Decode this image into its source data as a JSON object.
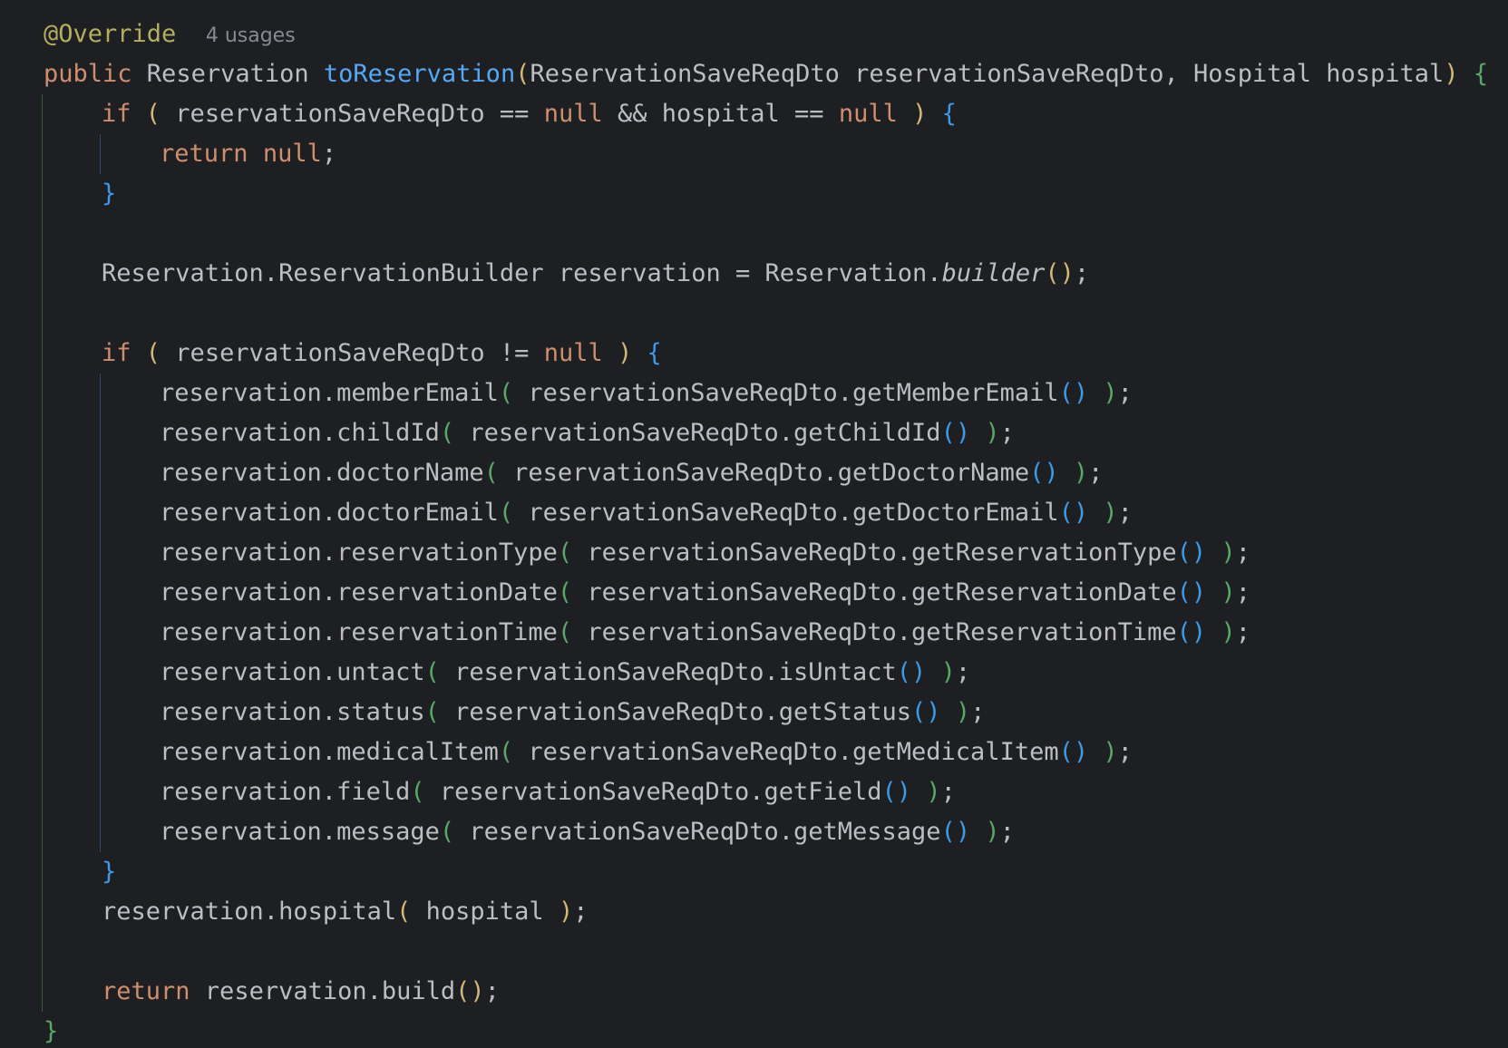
{
  "editor": {
    "colors": {
      "background": "#1e1f22",
      "default": "#bcbec4",
      "keyword": "#cf8e6d",
      "annotation": "#b3ae60",
      "method_decl": "#56a8f5",
      "inlay_hint": "#868a91",
      "brace_level1": "#59a869",
      "brace_level2": "#d5b778",
      "brace_level3": "#3d9ae8"
    },
    "lines": [
      {
        "indent": 0,
        "tokens": [
          {
            "t": "@Override",
            "c": "annotation"
          },
          {
            "t": "  ",
            "c": "default"
          },
          {
            "t": "4 usages",
            "c": "hint"
          }
        ]
      },
      {
        "indent": 0,
        "tokens": [
          {
            "t": "public",
            "c": "keyword"
          },
          {
            "t": " Reservation ",
            "c": "default"
          },
          {
            "t": "toReservation",
            "c": "method_decl"
          },
          {
            "t": "(",
            "c": "brace_level2"
          },
          {
            "t": "ReservationSaveReqDto reservationSaveReqDto, Hospital hospital",
            "c": "default"
          },
          {
            "t": ")",
            "c": "brace_level2"
          },
          {
            "t": " ",
            "c": "default"
          },
          {
            "t": "{",
            "c": "brace_level1"
          }
        ]
      },
      {
        "indent": 1,
        "tokens": [
          {
            "t": "if",
            "c": "keyword"
          },
          {
            "t": " ",
            "c": "default"
          },
          {
            "t": "(",
            "c": "brace_level2"
          },
          {
            "t": " reservationSaveReqDto == ",
            "c": "default"
          },
          {
            "t": "null",
            "c": "keyword"
          },
          {
            "t": " && hospital == ",
            "c": "default"
          },
          {
            "t": "null",
            "c": "keyword"
          },
          {
            "t": " ",
            "c": "default"
          },
          {
            "t": ")",
            "c": "brace_level2"
          },
          {
            "t": " ",
            "c": "default"
          },
          {
            "t": "{",
            "c": "brace_level3"
          }
        ]
      },
      {
        "indent": 2,
        "tokens": [
          {
            "t": "return",
            "c": "keyword"
          },
          {
            "t": " ",
            "c": "default"
          },
          {
            "t": "null",
            "c": "keyword"
          },
          {
            "t": ";",
            "c": "default"
          }
        ]
      },
      {
        "indent": 1,
        "tokens": [
          {
            "t": "}",
            "c": "brace_level3"
          }
        ]
      },
      {
        "indent": 0,
        "tokens": []
      },
      {
        "indent": 1,
        "tokens": [
          {
            "t": "Reservation.ReservationBuilder reservation = Reservation.",
            "c": "default"
          },
          {
            "t": "builder",
            "c": "italic"
          },
          {
            "t": "()",
            "c": "brace_level2"
          },
          {
            "t": ";",
            "c": "default"
          }
        ]
      },
      {
        "indent": 0,
        "tokens": []
      },
      {
        "indent": 1,
        "tokens": [
          {
            "t": "if",
            "c": "keyword"
          },
          {
            "t": " ",
            "c": "default"
          },
          {
            "t": "(",
            "c": "brace_level2"
          },
          {
            "t": " reservationSaveReqDto != ",
            "c": "default"
          },
          {
            "t": "null",
            "c": "keyword"
          },
          {
            "t": " ",
            "c": "default"
          },
          {
            "t": ")",
            "c": "brace_level2"
          },
          {
            "t": " ",
            "c": "default"
          },
          {
            "t": "{",
            "c": "brace_level3"
          }
        ]
      },
      {
        "indent": 2,
        "tokens": [
          {
            "t": "reservation.memberEmail",
            "c": "default"
          },
          {
            "t": "(",
            "c": "brace_level1"
          },
          {
            "t": " reservationSaveReqDto.getMemberEmail",
            "c": "default"
          },
          {
            "t": "()",
            "c": "brace_level3"
          },
          {
            "t": " ",
            "c": "default"
          },
          {
            "t": ")",
            "c": "brace_level1"
          },
          {
            "t": ";",
            "c": "default"
          }
        ]
      },
      {
        "indent": 2,
        "tokens": [
          {
            "t": "reservation.childId",
            "c": "default"
          },
          {
            "t": "(",
            "c": "brace_level1"
          },
          {
            "t": " reservationSaveReqDto.getChildId",
            "c": "default"
          },
          {
            "t": "()",
            "c": "brace_level3"
          },
          {
            "t": " ",
            "c": "default"
          },
          {
            "t": ")",
            "c": "brace_level1"
          },
          {
            "t": ";",
            "c": "default"
          }
        ]
      },
      {
        "indent": 2,
        "tokens": [
          {
            "t": "reservation.doctorName",
            "c": "default"
          },
          {
            "t": "(",
            "c": "brace_level1"
          },
          {
            "t": " reservationSaveReqDto.getDoctorName",
            "c": "default"
          },
          {
            "t": "()",
            "c": "brace_level3"
          },
          {
            "t": " ",
            "c": "default"
          },
          {
            "t": ")",
            "c": "brace_level1"
          },
          {
            "t": ";",
            "c": "default"
          }
        ]
      },
      {
        "indent": 2,
        "tokens": [
          {
            "t": "reservation.doctorEmail",
            "c": "default"
          },
          {
            "t": "(",
            "c": "brace_level1"
          },
          {
            "t": " reservationSaveReqDto.getDoctorEmail",
            "c": "default"
          },
          {
            "t": "()",
            "c": "brace_level3"
          },
          {
            "t": " ",
            "c": "default"
          },
          {
            "t": ")",
            "c": "brace_level1"
          },
          {
            "t": ";",
            "c": "default"
          }
        ]
      },
      {
        "indent": 2,
        "tokens": [
          {
            "t": "reservation.reservationType",
            "c": "default"
          },
          {
            "t": "(",
            "c": "brace_level1"
          },
          {
            "t": " reservationSaveReqDto.getReservationType",
            "c": "default"
          },
          {
            "t": "()",
            "c": "brace_level3"
          },
          {
            "t": " ",
            "c": "default"
          },
          {
            "t": ")",
            "c": "brace_level1"
          },
          {
            "t": ";",
            "c": "default"
          }
        ]
      },
      {
        "indent": 2,
        "tokens": [
          {
            "t": "reservation.reservationDate",
            "c": "default"
          },
          {
            "t": "(",
            "c": "brace_level1"
          },
          {
            "t": " reservationSaveReqDto.getReservationDate",
            "c": "default"
          },
          {
            "t": "()",
            "c": "brace_level3"
          },
          {
            "t": " ",
            "c": "default"
          },
          {
            "t": ")",
            "c": "brace_level1"
          },
          {
            "t": ";",
            "c": "default"
          }
        ]
      },
      {
        "indent": 2,
        "tokens": [
          {
            "t": "reservation.reservationTime",
            "c": "default"
          },
          {
            "t": "(",
            "c": "brace_level1"
          },
          {
            "t": " reservationSaveReqDto.getReservationTime",
            "c": "default"
          },
          {
            "t": "()",
            "c": "brace_level3"
          },
          {
            "t": " ",
            "c": "default"
          },
          {
            "t": ")",
            "c": "brace_level1"
          },
          {
            "t": ";",
            "c": "default"
          }
        ]
      },
      {
        "indent": 2,
        "tokens": [
          {
            "t": "reservation.untact",
            "c": "default"
          },
          {
            "t": "(",
            "c": "brace_level1"
          },
          {
            "t": " reservationSaveReqDto.isUntact",
            "c": "default"
          },
          {
            "t": "()",
            "c": "brace_level3"
          },
          {
            "t": " ",
            "c": "default"
          },
          {
            "t": ")",
            "c": "brace_level1"
          },
          {
            "t": ";",
            "c": "default"
          }
        ]
      },
      {
        "indent": 2,
        "tokens": [
          {
            "t": "reservation.status",
            "c": "default"
          },
          {
            "t": "(",
            "c": "brace_level1"
          },
          {
            "t": " reservationSaveReqDto.getStatus",
            "c": "default"
          },
          {
            "t": "()",
            "c": "brace_level3"
          },
          {
            "t": " ",
            "c": "default"
          },
          {
            "t": ")",
            "c": "brace_level1"
          },
          {
            "t": ";",
            "c": "default"
          }
        ]
      },
      {
        "indent": 2,
        "tokens": [
          {
            "t": "reservation.medicalItem",
            "c": "default"
          },
          {
            "t": "(",
            "c": "brace_level1"
          },
          {
            "t": " reservationSaveReqDto.getMedicalItem",
            "c": "default"
          },
          {
            "t": "()",
            "c": "brace_level3"
          },
          {
            "t": " ",
            "c": "default"
          },
          {
            "t": ")",
            "c": "brace_level1"
          },
          {
            "t": ";",
            "c": "default"
          }
        ]
      },
      {
        "indent": 2,
        "tokens": [
          {
            "t": "reservation.field",
            "c": "default"
          },
          {
            "t": "(",
            "c": "brace_level1"
          },
          {
            "t": " reservationSaveReqDto.getField",
            "c": "default"
          },
          {
            "t": "()",
            "c": "brace_level3"
          },
          {
            "t": " ",
            "c": "default"
          },
          {
            "t": ")",
            "c": "brace_level1"
          },
          {
            "t": ";",
            "c": "default"
          }
        ]
      },
      {
        "indent": 2,
        "tokens": [
          {
            "t": "reservation.message",
            "c": "default"
          },
          {
            "t": "(",
            "c": "brace_level1"
          },
          {
            "t": " reservationSaveReqDto.getMessage",
            "c": "default"
          },
          {
            "t": "()",
            "c": "brace_level3"
          },
          {
            "t": " ",
            "c": "default"
          },
          {
            "t": ")",
            "c": "brace_level1"
          },
          {
            "t": ";",
            "c": "default"
          }
        ]
      },
      {
        "indent": 1,
        "tokens": [
          {
            "t": "}",
            "c": "brace_level3"
          }
        ]
      },
      {
        "indent": 1,
        "tokens": [
          {
            "t": "reservation.hospital",
            "c": "default"
          },
          {
            "t": "(",
            "c": "brace_level2"
          },
          {
            "t": " hospital ",
            "c": "default"
          },
          {
            "t": ")",
            "c": "brace_level2"
          },
          {
            "t": ";",
            "c": "default"
          }
        ]
      },
      {
        "indent": 0,
        "tokens": []
      },
      {
        "indent": 1,
        "tokens": [
          {
            "t": "return",
            "c": "keyword"
          },
          {
            "t": " reservation.build",
            "c": "default"
          },
          {
            "t": "()",
            "c": "brace_level2"
          },
          {
            "t": ";",
            "c": "default"
          }
        ]
      },
      {
        "indent": 0,
        "tokens": [
          {
            "t": "}",
            "c": "brace_level1"
          }
        ]
      }
    ]
  }
}
